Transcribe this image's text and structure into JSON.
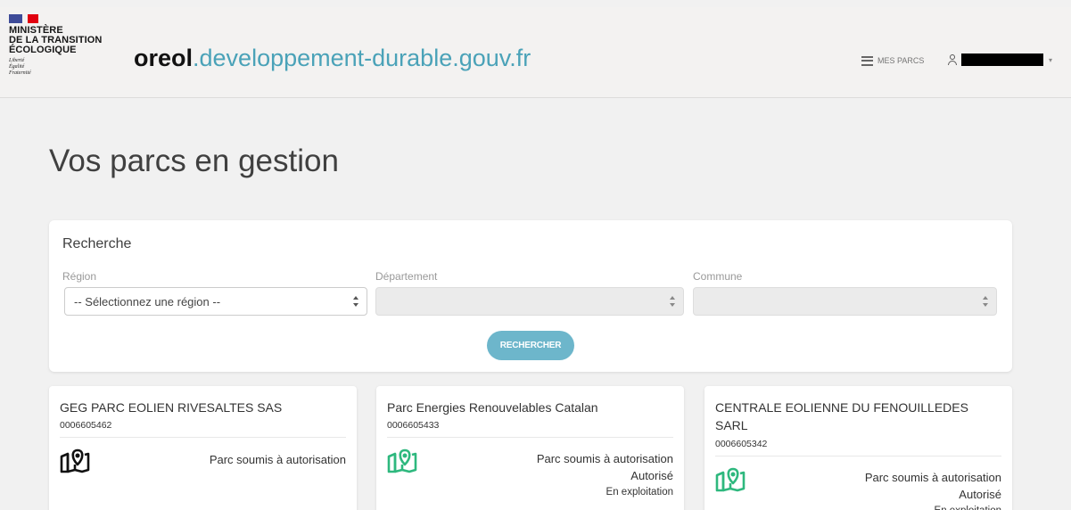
{
  "header": {
    "ministry_lines": "MINISTÈRE\nDE LA TRANSITION\nÉCOLOGIQUE",
    "devise": "Liberté\nÉgalité\nFraternité",
    "site_name_bold": "oreol",
    "site_name_rest": ".developpement-durable.gouv.fr",
    "nav_parcs_label": "MES PARCS",
    "user_icon": "user-icon",
    "parcs_icon": "list-icon"
  },
  "page": {
    "title": "Vos parcs en gestion"
  },
  "search": {
    "title": "Recherche",
    "region_label": "Région",
    "region_value": "-- Sélectionnez une région --",
    "departement_label": "Département",
    "departement_value": "",
    "commune_label": "Commune",
    "commune_value": "",
    "button_label": "RECHERCHER"
  },
  "colors": {
    "accent": "#6db6cb",
    "brand_blue_text": "#4aa2b8",
    "map_icon_green": "#2eb87e"
  },
  "parcs": [
    {
      "name": "GEG PARC EOLIEN RIVESALTES SAS",
      "id": "0006605462",
      "icon": "map-pin-icon",
      "icon_color": "black",
      "status": [
        "Parc soumis à autorisation"
      ]
    },
    {
      "name": "Parc Energies Renouvelables Catalan",
      "id": "0006605433",
      "icon": "map-pin-icon",
      "icon_color": "green",
      "status": [
        "Parc soumis à autorisation",
        "Autorisé",
        "En exploitation"
      ]
    },
    {
      "name": "CENTRALE EOLIENNE DU FENOUILLEDES SARL",
      "id": "0006605342",
      "icon": "map-pin-icon",
      "icon_color": "green",
      "status": [
        "Parc soumis à autorisation",
        "Autorisé",
        "En exploitation"
      ]
    }
  ]
}
